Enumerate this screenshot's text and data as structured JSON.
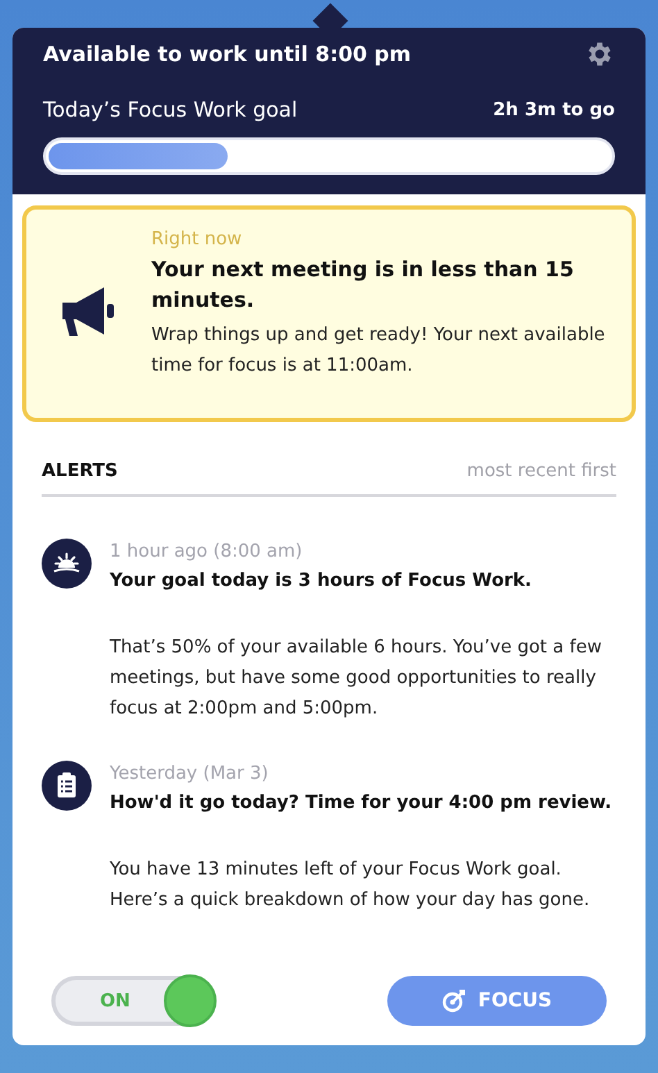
{
  "header": {
    "title": "Available to work until 8:00 pm",
    "goal_label": "Today’s Focus Work goal",
    "goal_remaining": "2h 3m to go",
    "level": 0.32
  },
  "notice": {
    "eyebrow": "Right now",
    "title": "Your next meeting is in less than 15 minutes.",
    "body": "Wrap things up and get ready! Your next available time for focus is at 11:00am."
  },
  "alerts": {
    "heading": "ALERTS",
    "sort": "most recent first",
    "items": [
      {
        "kind": "sunrise",
        "time": "1 hour ago (8:00 am)",
        "title": "Your goal today is 3 hours of Focus Work.",
        "body": "That’s 50% of your available 6 hours. You’ve got a few meetings, but have some good opportunities to really focus at 2:00pm and 5:00pm."
      },
      {
        "kind": "clipboard",
        "time": "Yesterday (Mar 3)",
        "title": "How'd it go today? Time for your 4:00 pm review.",
        "body": "You have 13 minutes left of your Focus Work goal. Here’s a quick breakdown of how your day has gone."
      }
    ]
  },
  "footer": {
    "toggle_label": "ON",
    "on": true,
    "focus_button": "FOCUS"
  }
}
